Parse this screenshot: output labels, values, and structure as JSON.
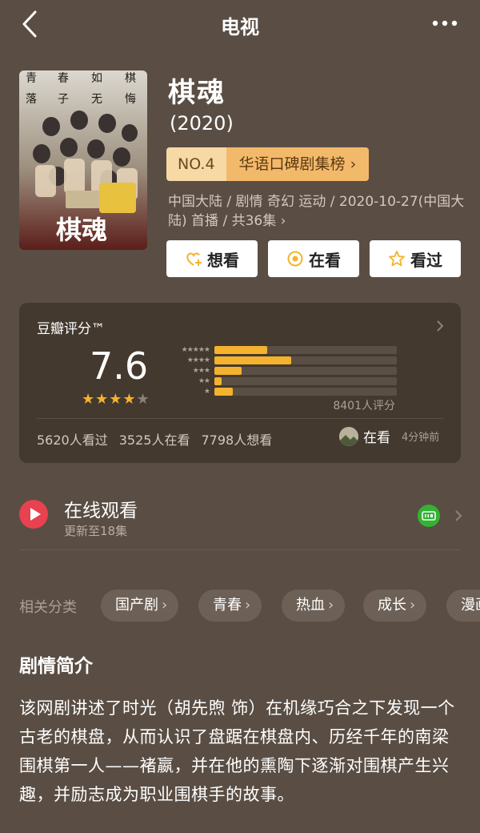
{
  "header": {
    "title": "电视"
  },
  "show": {
    "title": "棋魂",
    "year": "(2020)",
    "rank_no": "NO.4",
    "rank_list": "华语口碑剧集榜",
    "meta": "中国大陆 / 剧情 奇幻 运动 / 2020-10-27(中国大陆) 首播 / 共36集 ›",
    "poster_texts": [
      "青",
      "春",
      "如",
      "棋",
      "落",
      "子",
      "无",
      "悔"
    ],
    "poster_logo": "棋魂"
  },
  "actions": {
    "want": "想看",
    "watching": "在看",
    "watched": "看过"
  },
  "rating": {
    "label": "豆瓣评分™",
    "score": "7.6",
    "stars": "★★★★",
    "star_off": "★",
    "count": "8401人评分",
    "distribution": [
      {
        "stars": "★★★★★",
        "fraction": 0.29
      },
      {
        "stars": "★★★★",
        "fraction": 0.42
      },
      {
        "stars": "★★★",
        "fraction": 0.15
      },
      {
        "stars": "★★",
        "fraction": 0.04
      },
      {
        "stars": "★",
        "fraction": 0.1
      }
    ],
    "stats": [
      "5620人看过",
      "3525人在看",
      "7798人想看"
    ],
    "friend_status": "在看",
    "friend_time": "4分钟前"
  },
  "watch": {
    "title": "在线观看",
    "subtitle": "更新至18集"
  },
  "categories": {
    "label": "相关分类",
    "tags": [
      "国产剧",
      "青春",
      "热血",
      "成长",
      "漫画"
    ]
  },
  "synopsis": {
    "title": "剧情简介",
    "text": "该网剧讲述了时光（胡先煦 饰）在机缘巧合之下发现一个古老的棋盘，从而认识了盘踞在棋盘内、历经千年的南梁围棋第一人——褚嬴，并在他的熏陶下逐渐对围棋产生兴趣，并励志成为职业围棋手的故事。"
  },
  "colors": {
    "background": "#5a4e44",
    "card": "#43392f",
    "star": "#f5b22e",
    "rank_no_bg": "#f7d9a6",
    "rank_name_bg": "#f3b96b",
    "play_red": "#e8414f",
    "iqiyi_green": "#34b233"
  },
  "icons": {
    "back": "back-chevron-icon",
    "more": "more-dots-icon",
    "want": "plus-heart-icon",
    "watching": "target-circle-icon",
    "watched": "star-outline-icon",
    "play": "play-circle-icon",
    "platform": "iqiyi-logo-icon"
  }
}
